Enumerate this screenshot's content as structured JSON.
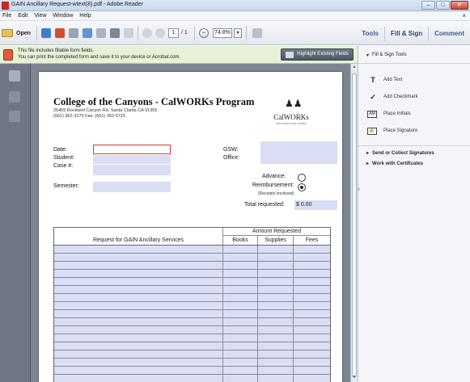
{
  "window": {
    "title": "GAIN Ancillary Request-wtext(8).pdf - Adobe Reader",
    "minimize": "–",
    "maximize": "□",
    "close": "✕"
  },
  "menubar": {
    "items": [
      "File",
      "Edit",
      "View",
      "Window",
      "Help"
    ],
    "close": "×"
  },
  "toolbar": {
    "open_label": "Open",
    "current_page": "1",
    "total_pages": "/ 1",
    "zoom_out": "−",
    "zoom": "74.8%",
    "zoom_dropdown": "▾",
    "tabs": [
      "Tools",
      "Fill & Sign",
      "Comment"
    ]
  },
  "notification": {
    "line1": "This file includes fillable form fields.",
    "line2": "You can print the completed form and save it to your device or Acrobat.com.",
    "highlight_button": "Highlight Existing Fields"
  },
  "form": {
    "title": "College of the Canyons - CalWORKs Program",
    "address": "26455 Rockwell Canyon Rd.  Santa Clarita  CA  91355",
    "phone": "(661) 362-3279        Fax: (661) 362-5715",
    "logo_text": "CalWORKs",
    "logo_tagline": "EDUCATION THAT WORKS",
    "labels": {
      "date": "Date:",
      "student": "Student:",
      "case": "Case #:",
      "semester": "Semester:",
      "gsw": "GSW:",
      "office": "Office:",
      "advance": "Advance:",
      "reimbursement": "Reimbursement:",
      "receipts": "(Receipts enclosed)",
      "total_requested": "Total requested:"
    },
    "total_value": "$ 0.00",
    "reimbursement_selected": true,
    "table": {
      "amount_header": "Amount Requested",
      "services_header": "Request for GAIN Ancillary Services",
      "columns": [
        "Books",
        "Supplies",
        "Fees"
      ],
      "rows": [
        [
          "",
          "",
          "",
          ""
        ],
        [
          "",
          "",
          "",
          ""
        ],
        [
          "",
          "",
          "",
          ""
        ],
        [
          "",
          "",
          "",
          ""
        ],
        [
          "",
          "",
          "",
          ""
        ],
        [
          "",
          "",
          "",
          ""
        ],
        [
          "",
          "",
          "",
          ""
        ],
        [
          "",
          "",
          "",
          ""
        ],
        [
          "",
          "",
          "",
          ""
        ],
        [
          "",
          "",
          "",
          ""
        ],
        [
          "",
          "",
          "",
          ""
        ],
        [
          "",
          "",
          "",
          ""
        ],
        [
          "",
          "",
          "",
          ""
        ],
        [
          "",
          "",
          "",
          ""
        ],
        [
          "",
          "",
          "",
          ""
        ],
        [
          "",
          "",
          "",
          ""
        ],
        [
          "",
          "",
          "",
          ""
        ],
        [
          "",
          "",
          "",
          ""
        ],
        [
          "",
          "",
          "",
          ""
        ]
      ]
    }
  },
  "right_panel": {
    "header": "Fill & Sign Tools",
    "items": [
      {
        "icon": "text-icon",
        "glyph": "T",
        "label": "Add Text"
      },
      {
        "icon": "checkmark-icon",
        "glyph": "✓",
        "label": "Add Checkmark"
      },
      {
        "icon": "initials-icon",
        "glyph": "AM",
        "label": "Place Initials"
      },
      {
        "icon": "signature-icon",
        "glyph": "✍",
        "label": "Place Signature"
      }
    ],
    "sections": [
      "Send or Collect Signatures",
      "Work with Certificates"
    ]
  }
}
